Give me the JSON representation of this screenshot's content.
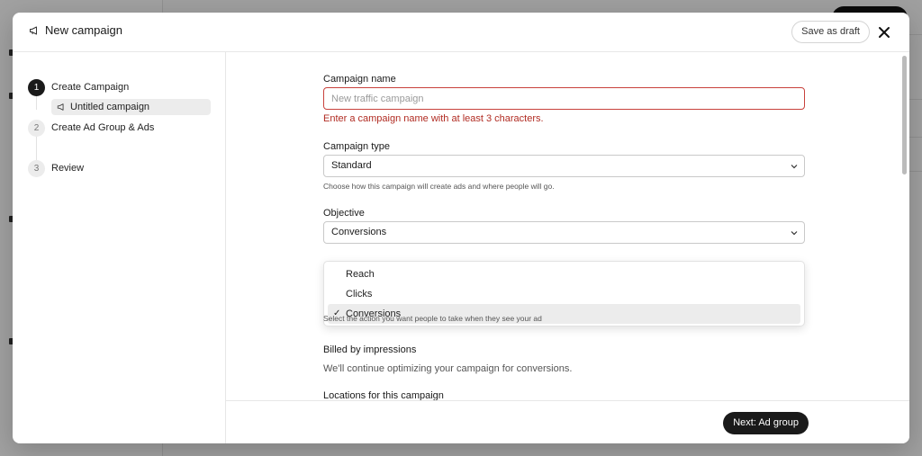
{
  "modal": {
    "title": "New campaign",
    "save_draft_label": "Save as draft"
  },
  "steps": [
    {
      "number": "1",
      "label": "Create Campaign"
    },
    {
      "number": "2",
      "label": "Create Ad Group & Ads"
    },
    {
      "number": "3",
      "label": "Review"
    }
  ],
  "substep": {
    "label": "Untitled campaign"
  },
  "form": {
    "campaign_name": {
      "label": "Campaign name",
      "placeholder": "New traffic campaign",
      "error": "Enter a campaign name with at least 3 characters."
    },
    "campaign_type": {
      "label": "Campaign type",
      "value": "Standard",
      "help": "Choose how this campaign will create ads and where people will go."
    },
    "objective": {
      "label": "Objective",
      "value": "Conversions",
      "options": [
        "Reach",
        "Clicks",
        "Conversions"
      ],
      "help": "Select the action you want people to take when they see your ad"
    },
    "billing": {
      "label": "Billed by impressions",
      "text": "We'll continue optimizing your campaign for conversions."
    },
    "locations": {
      "label": "Locations for this campaign"
    }
  },
  "footer": {
    "next_label": "Next: Ad group"
  },
  "colors": {
    "error": "#b12c23",
    "primary": "#1a1a1a"
  }
}
